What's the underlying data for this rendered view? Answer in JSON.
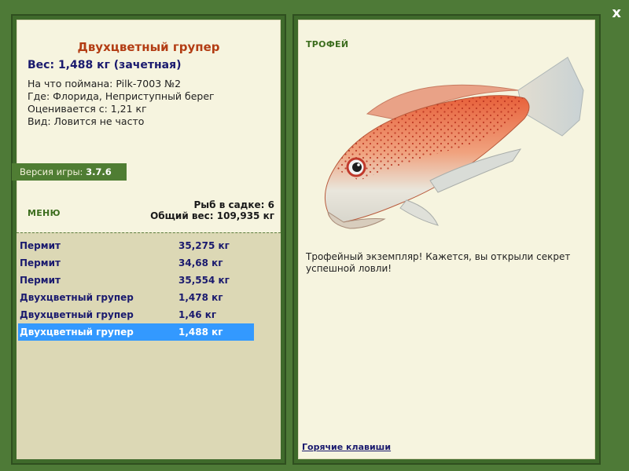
{
  "close_label": "x",
  "fish": {
    "title": "Двухцветный групер",
    "weight_line": "Вес: 1,488 кг (зачетная)",
    "caught_on": "На что поймана: Pilk-7003 №2",
    "location": "Где: Флорида, Неприступный берег",
    "value": "Оценивается с: 1,21 кг",
    "rarity": "Вид: Ловится не часто"
  },
  "version": {
    "label": "Версия игры:",
    "number": "3.7.6"
  },
  "menu_label": "МЕНЮ",
  "keepnet": {
    "count_line": "Рыб в садке: 6",
    "total_line": "Общий вес: 109,935 кг"
  },
  "catches": [
    {
      "name": "Пермит",
      "weight": "35,275 кг"
    },
    {
      "name": "Пермит",
      "weight": "34,68 кг"
    },
    {
      "name": "Пермит",
      "weight": "35,554 кг"
    },
    {
      "name": "Двухцветный групер",
      "weight": "1,478 кг"
    },
    {
      "name": "Двухцветный групер",
      "weight": "1,46 кг"
    },
    {
      "name": "Двухцветный групер",
      "weight": "1,488 кг"
    }
  ],
  "selected_catch_index": 5,
  "trophy": {
    "label": "ТРОФЕЙ",
    "text": "Трофейный экземпляр! Кажется, вы открыли секрет успешной ловли!"
  },
  "hotkeys_label": "Горячие клавиши",
  "colors": {
    "background": "#4e7a37",
    "panel": "#f6f4df",
    "title": "#b33d14",
    "selection": "#3399ff"
  }
}
